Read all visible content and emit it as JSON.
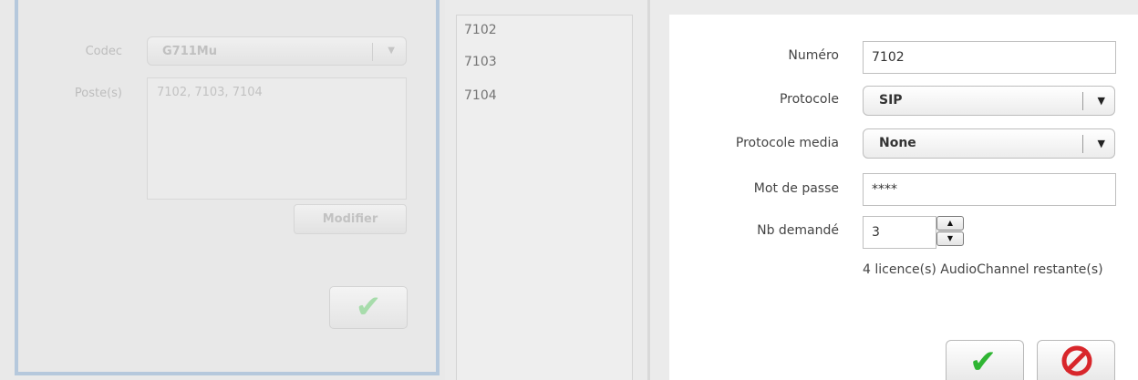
{
  "left_panel": {
    "codec_label": "Codec",
    "codec_value": "G711Mu",
    "postes_label": "Poste(s)",
    "postes_value": "7102, 7103, 7104",
    "modifier_label": "Modifier",
    "ok_glyph": "✔"
  },
  "poste_list": {
    "items": [
      "7102",
      "7103",
      "7104"
    ]
  },
  "form": {
    "numero_label": "Numéro",
    "numero_value": "7102",
    "protocole_label": "Protocole",
    "protocole_value": "SIP",
    "protocole_media_label": "Protocole media",
    "protocole_media_value": "None",
    "password_label": "Mot de passe",
    "password_value": "****",
    "nb_label": "Nb demandé",
    "nb_value": "3",
    "licence_text": "4 licence(s) AudioChannel restante(s)",
    "arrow_glyph": "▼",
    "spin_up": "▲",
    "spin_down": "▼",
    "ok_glyph": "✔"
  },
  "colors": {
    "accent_green": "#2fb533",
    "cancel_red": "#d8262b",
    "disabled_border": "#b5c8dc"
  }
}
